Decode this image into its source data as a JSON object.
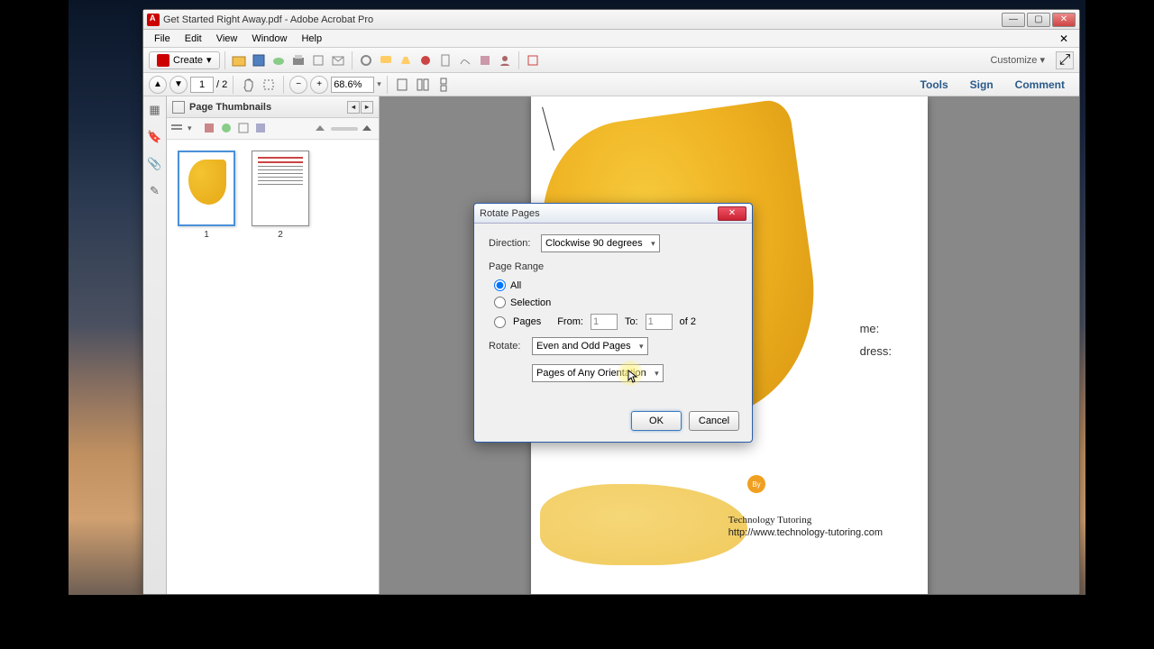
{
  "window": {
    "title": "Get Started Right Away.pdf - Adobe Acrobat Pro",
    "min": "—",
    "max": "▢",
    "close": "✕"
  },
  "menubar": [
    "File",
    "Edit",
    "View",
    "Window",
    "Help"
  ],
  "toolbar": {
    "create": "Create",
    "customize": "Customize"
  },
  "navbar": {
    "page_current": "1",
    "page_sep": "/",
    "page_total": "2",
    "zoom": "68.6%"
  },
  "right_tools": [
    "Tools",
    "Sign",
    "Comment"
  ],
  "thumbnails": {
    "title": "Page Thumbnails",
    "pages": [
      "1",
      "2"
    ]
  },
  "document": {
    "by": "By",
    "footer_line1": "Technology Tutoring",
    "footer_line2": "http://www.technology-tutoring.com",
    "field1": "me:",
    "field2": "dress:"
  },
  "dialog": {
    "title": "Rotate Pages",
    "direction_label": "Direction:",
    "direction_value": "Clockwise 90 degrees",
    "page_range": "Page Range",
    "opt_all": "All",
    "opt_selection": "Selection",
    "opt_pages": "Pages",
    "from": "From:",
    "from_val": "1",
    "to": "To:",
    "to_val": "1",
    "of": "of 2",
    "rotate_label": "Rotate:",
    "rotate_value": "Even and Odd Pages",
    "orient_value": "Pages of Any Orientation",
    "ok": "OK",
    "cancel": "Cancel"
  }
}
